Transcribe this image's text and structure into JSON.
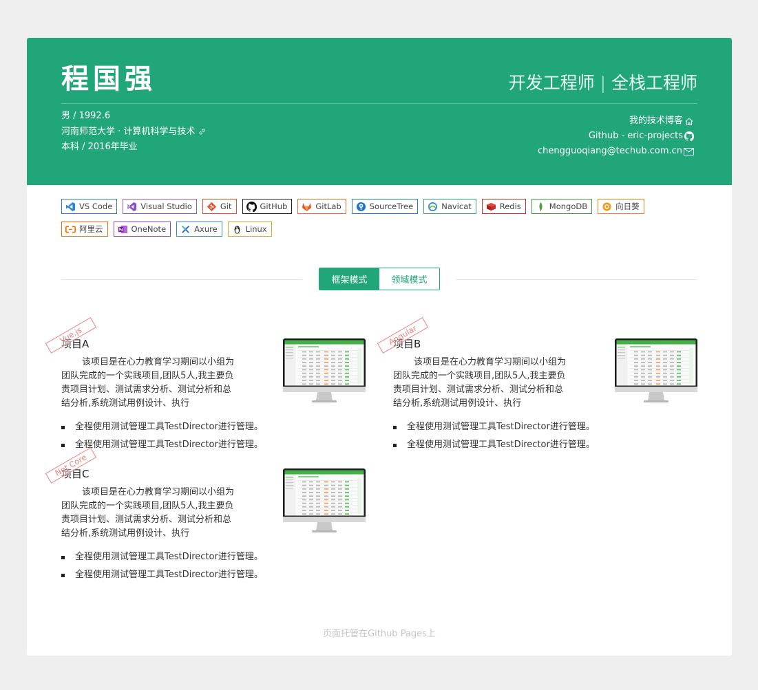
{
  "header": {
    "name": "程国强",
    "role": "开发工程师 | 全栈工程师",
    "gender_birth": "男 / 1992.6",
    "school": "河南师范大学 · 计算机科学与技术",
    "degree": "本科 / 2016年毕业",
    "blog_label": "我的技术博客",
    "github_label": "Github - eric-projects",
    "email": "chengguoqiang@techub.com.cn",
    "brand_color": "#21a67a"
  },
  "skills": {
    "row1": [
      {
        "label": "VS Code",
        "icon": "vscode-icon",
        "border": "#3a7bd5"
      },
      {
        "label": "Visual Studio",
        "icon": "visual-studio-icon",
        "border": "#8a5fc7"
      },
      {
        "label": "Git",
        "icon": "git-icon",
        "border": "#e0502e"
      },
      {
        "label": "GitHub",
        "icon": "github-icon",
        "border": "#222222"
      },
      {
        "label": "GitLab",
        "icon": "gitlab-icon",
        "border": "#e2703a"
      },
      {
        "label": "SourceTree",
        "icon": "sourcetree-icon",
        "border": "#2a7ec9"
      },
      {
        "label": "Navicat",
        "icon": "navicat-icon",
        "border": "#3aa870"
      },
      {
        "label": "Redis",
        "icon": "redis-icon",
        "border": "#c8332b"
      },
      {
        "label": "MongoDB",
        "icon": "mongodb-icon",
        "border": "#4a9b45"
      },
      {
        "label": "向日葵",
        "icon": "sunflower-icon",
        "border": "#e8842a"
      }
    ],
    "row2": [
      {
        "label": "阿里云",
        "icon": "aliyun-icon",
        "border": "#e8700a"
      },
      {
        "label": "OneNote",
        "icon": "onenote-icon",
        "border": "#8d3fc0"
      },
      {
        "label": "Axure",
        "icon": "axure-icon",
        "border": "#3a86c8"
      },
      {
        "label": "Linux",
        "icon": "linux-icon",
        "border": "#d8a823"
      }
    ]
  },
  "modes": {
    "active": "框架模式",
    "inactive": "领域模式"
  },
  "projects": [
    {
      "ribbon": "Vue.js",
      "title": "项目A",
      "description": "该项目是在心力教育学习期间以小组为团队完成的一个实践项目,团队5人,我主要负责项目计划、测试需求分析、测试分析和总结分析,系统测试用例设计、执行",
      "items": [
        "全程使用测试管理工具TestDirector进行管理。",
        "全程使用测试管理工具TestDirector进行管理。"
      ]
    },
    {
      "ribbon": "Angular",
      "title": "项目B",
      "description": "该项目是在心力教育学习期间以小组为团队完成的一个实践项目,团队5人,我主要负责项目计划、测试需求分析、测试分析和总结分析,系统测试用例设计、执行",
      "items": [
        "全程使用测试管理工具TestDirector进行管理。",
        "全程使用测试管理工具TestDirector进行管理。"
      ]
    },
    {
      "ribbon": "Net Core",
      "title": "项目C",
      "description": "该项目是在心力教育学习期间以小组为团队完成的一个实践项目,团队5人,我主要负责项目计划、测试需求分析、测试分析和总结分析,系统测试用例设计、执行",
      "items": [
        "全程使用测试管理工具TestDirector进行管理。",
        "全程使用测试管理工具TestDirector进行管理。"
      ]
    }
  ],
  "footer": "页面托管在Github Pages上"
}
